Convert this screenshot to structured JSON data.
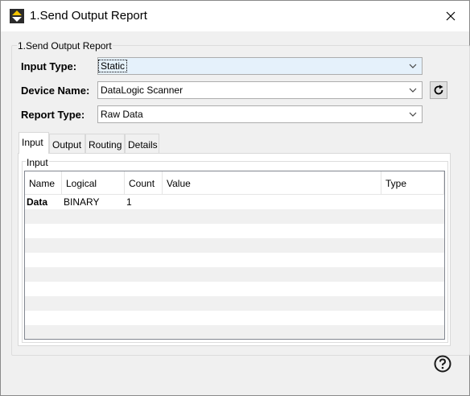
{
  "window": {
    "title": "1.Send Output Report",
    "icon": "arrows-updown-icon",
    "close_icon": "close-icon"
  },
  "group": {
    "legend": "1.Send Output Report"
  },
  "form": {
    "input_type": {
      "label": "Input Type:",
      "value": "Static"
    },
    "device_name": {
      "label": "Device Name:",
      "value": "DataLogic Scanner"
    },
    "report_type": {
      "label": "Report Type:",
      "value": "Raw Data"
    }
  },
  "tabs": [
    {
      "label": "Input",
      "active": true
    },
    {
      "label": "Output",
      "active": false
    },
    {
      "label": "Routing",
      "active": false
    },
    {
      "label": "Details",
      "active": false
    }
  ],
  "input_panel": {
    "legend": "Input",
    "columns": [
      "Name",
      "Logical",
      "Count",
      "Value",
      "Type"
    ],
    "rows": [
      {
        "name": "Data",
        "logical": "BINARY",
        "count": "1",
        "value": "",
        "type": ""
      }
    ]
  },
  "help_icon": "help-circle-icon"
}
